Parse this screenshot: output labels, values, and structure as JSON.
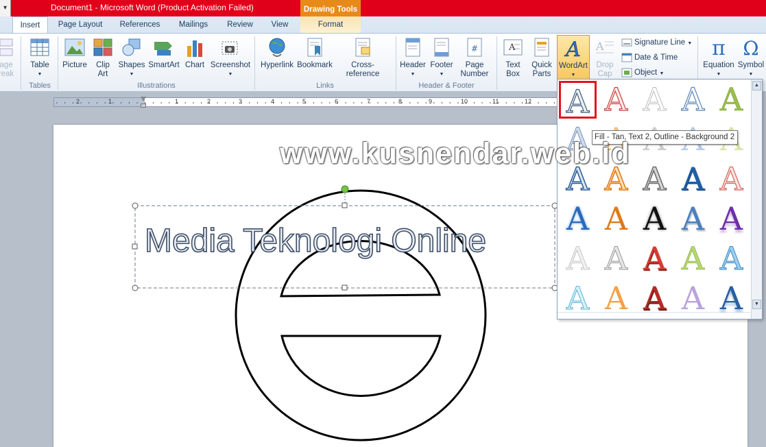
{
  "window": {
    "title": "Document1  -  Microsoft Word (Product Activation Failed)",
    "context_tab_group": "Drawing Tools",
    "system_menu_glyph": "▾"
  },
  "tabs": [
    {
      "label": "Insert",
      "active": true
    },
    {
      "label": "Page Layout"
    },
    {
      "label": "References"
    },
    {
      "label": "Mailings"
    },
    {
      "label": "Review"
    },
    {
      "label": "View"
    },
    {
      "label": "Format",
      "contextual": true
    }
  ],
  "ribbon": {
    "partial_left": {
      "line1": "age",
      "line2": "reak"
    },
    "tables": {
      "table_label": "Table",
      "group": "Tables"
    },
    "illustrations": {
      "picture": "Picture",
      "clip_art_1": "Clip",
      "clip_art_2": "Art",
      "shapes": "Shapes",
      "smartart": "SmartArt",
      "chart": "Chart",
      "screenshot": "Screenshot",
      "group": "Illustrations"
    },
    "links": {
      "hyperlink": "Hyperlink",
      "bookmark": "Bookmark",
      "cross_reference": "Cross-reference",
      "group": "Links"
    },
    "header_footer": {
      "header": "Header",
      "footer": "Footer",
      "page_number_1": "Page",
      "page_number_2": "Number",
      "group": "Header & Footer"
    },
    "text": {
      "text_box_1": "Text",
      "text_box_2": "Box",
      "quick_parts_1": "Quick",
      "quick_parts_2": "Parts",
      "wordart": "WordArt",
      "drop_cap_1": "Drop",
      "drop_cap_2": "Cap",
      "signature_line": "Signature Line",
      "date_time": "Date & Time",
      "object": "Object"
    },
    "symbols": {
      "equation": "Equation",
      "symbol": "Symbol"
    }
  },
  "ruler": {
    "numbers": [
      "2",
      "1",
      "1",
      "2",
      "3",
      "4",
      "5",
      "6",
      "7",
      "8",
      "9",
      "10",
      "11",
      "12"
    ]
  },
  "document": {
    "wordart_text": "Media Teknologi Online"
  },
  "gallery": {
    "glyph": "A",
    "tooltip": "Fill - Tan, Text 2, Outline - Background 2",
    "colors": {
      "selection_border": "#e0141e",
      "accent_blue": "#1f5fa8",
      "accent_orange": "#e07a10",
      "accent_red": "#c62828"
    }
  },
  "watermark": "www.kusnendar.web.id"
}
